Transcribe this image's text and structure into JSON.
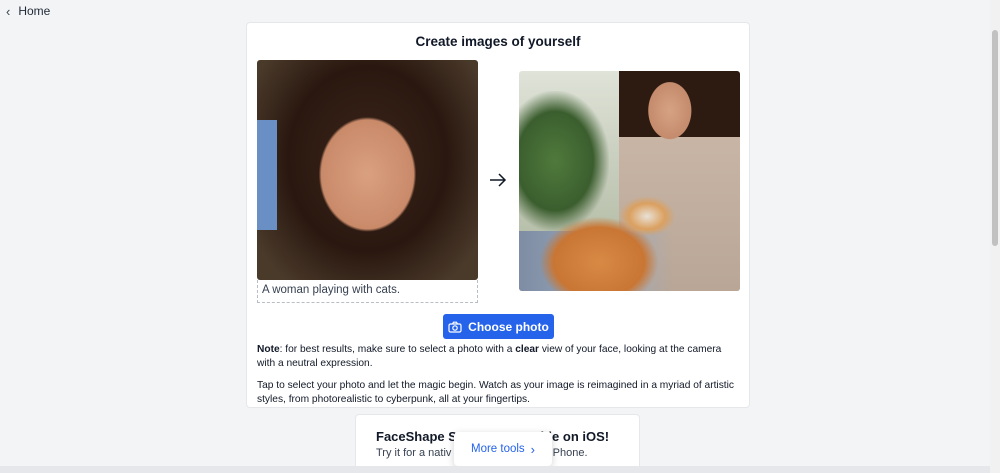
{
  "nav": {
    "back_label": "Home"
  },
  "card": {
    "title": "Create images of yourself",
    "caption": "A woman playing with cats.",
    "choose_button": "Choose photo",
    "note_label": "Note",
    "note_part1": ": for best results, make sure to select a photo with a ",
    "note_emphasis": "clear",
    "note_part2": " view of your face, looking at the camera with a neutral expression.",
    "tap_text": "Tap to select your photo and let the magic begin. Watch as your image is reimagined in a myriad of artistic styles, from photorealistic to cyberpunk, all at your fingertips."
  },
  "promo": {
    "title": "FaceShape St",
    "title_tail": "able on iOS!",
    "subtitle": "Try it for a nativ",
    "subtitle_tail": "ur iPhone."
  },
  "more_tools": {
    "label": "More tools"
  },
  "icons": {
    "back": "chevron-left-icon",
    "arrow": "arrow-right-icon",
    "camera": "camera-icon",
    "more": "chevron-right-icon"
  },
  "colors": {
    "primary": "#2563eb",
    "background": "#f3f4f6"
  }
}
